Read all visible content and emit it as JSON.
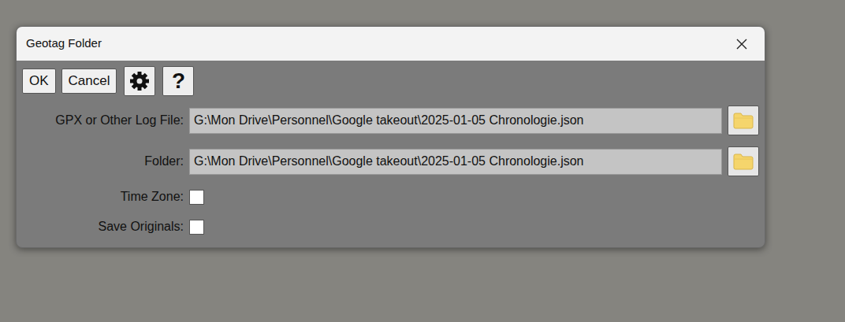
{
  "window": {
    "title": "Geotag Folder",
    "close": "×"
  },
  "toolbar": {
    "buttons": [
      "OK",
      "Cancel"
    ],
    "help": "?"
  },
  "rows": [
    {
      "kind": "file",
      "label": "GPX or Other Log File:",
      "value": "G:\\Mon Drive\\Personnel\\Google takeout\\2025-01-05 Chronologie.json",
      "checked": false
    },
    {
      "kind": "file",
      "label": "Folder:",
      "value": "G:\\Mon Drive\\Personnel\\Google takeout\\2025-01-05 Chronologie.json",
      "checked": false
    },
    {
      "kind": "checkbox",
      "label": "Time Zone:",
      "value": "",
      "checked": false
    },
    {
      "kind": "checkbox",
      "label": "Save Originals:",
      "value": "",
      "checked": false
    }
  ]
}
